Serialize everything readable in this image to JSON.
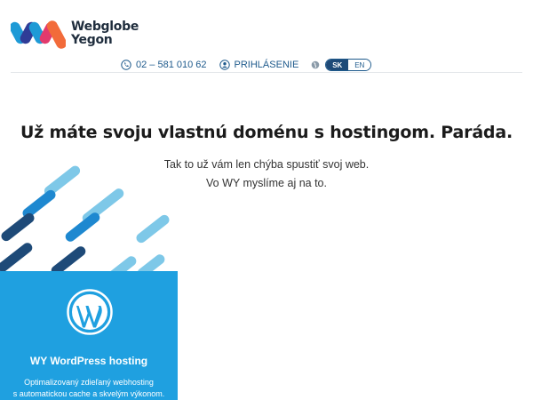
{
  "brand": {
    "name_line1": "Webglobe",
    "name_line2": "Yegon"
  },
  "header": {
    "phone": "02 – 581 010 62",
    "login": "PRIHLÁSENIE",
    "languages": [
      "SK",
      "EN"
    ],
    "active_language": "SK"
  },
  "hero": {
    "headline": "Už máte svoju vlastnú doménu s hostingom. Paráda.",
    "sub_line1": "Tak to už vám len chýba spustiť svoj web.",
    "sub_line2": "Vo WY myslíme aj na to."
  },
  "card": {
    "title": "WY WordPress hosting",
    "desc_line1": "Optimalizovaný zdieľaný webhosting",
    "desc_line2": "s automatickou cache a skvelým výkonom."
  },
  "colors": {
    "accent_blue": "#1fa0e0",
    "dark_blue": "#1e4a78",
    "light_blue": "#7ec8e8",
    "logo_orange": "#f26b3a"
  },
  "icons": {
    "phone": "phone-icon",
    "user": "user-icon",
    "globe": "globe-icon",
    "wordpress": "wordpress-icon"
  }
}
